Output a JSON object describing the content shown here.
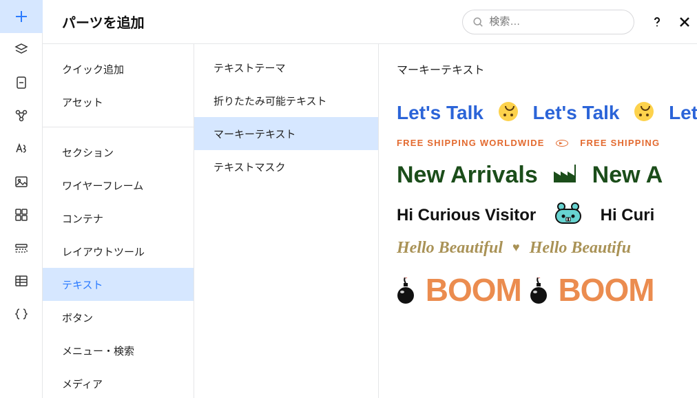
{
  "header": {
    "title": "パーツを追加",
    "search_placeholder": "検索…"
  },
  "rail_icons": [
    {
      "name": "add-icon",
      "active": true
    },
    {
      "name": "layers-icon"
    },
    {
      "name": "page-icon"
    },
    {
      "name": "nodes-icon"
    },
    {
      "name": "text-style-icon"
    },
    {
      "name": "image-icon"
    },
    {
      "name": "grid-icon"
    },
    {
      "name": "section-icon"
    },
    {
      "name": "table-icon"
    },
    {
      "name": "code-icon"
    }
  ],
  "menu_group1": [
    {
      "label": "クイック追加",
      "selected": false
    },
    {
      "label": "アセット",
      "selected": false
    }
  ],
  "menu_group2": [
    {
      "label": "セクション",
      "selected": false
    },
    {
      "label": "ワイヤーフレーム",
      "selected": false
    },
    {
      "label": "コンテナ",
      "selected": false
    },
    {
      "label": "レイアウトツール",
      "selected": false
    },
    {
      "label": "テキスト",
      "selected": true
    },
    {
      "label": "ボタン",
      "selected": false
    },
    {
      "label": "メニュー・検索",
      "selected": false
    },
    {
      "label": "メディア",
      "selected": false
    }
  ],
  "submenu": [
    {
      "label": "テキストテーマ",
      "selected": false
    },
    {
      "label": "折りたたみ可能テキスト",
      "selected": false
    },
    {
      "label": "マーキーテキスト",
      "selected": true
    },
    {
      "label": "テキストマスク",
      "selected": false
    }
  ],
  "preview": {
    "title": "マーキーテキスト",
    "rows": {
      "r1": "Let's Talk",
      "r2": "FREE SHIPPING WORLDWIDE",
      "r2b": "FREE SHIPPING",
      "r3": "New Arrivals",
      "r3b": "New A",
      "r4": "Hi Curious Visitor",
      "r4b": "Hi Curi",
      "r5": "Hello Beautiful",
      "r5b": "Hello Beautifu",
      "r6": "BOOM",
      "r6b": "BOOM"
    }
  }
}
